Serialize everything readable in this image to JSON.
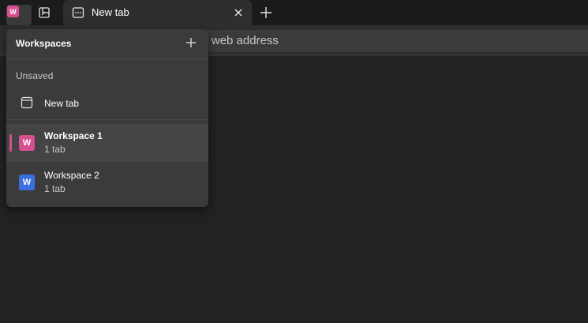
{
  "colors": {
    "accent_pink": "#d6508f",
    "accent_blue": "#3b6fe0"
  },
  "tabstrip": {
    "workspace_badge": "W",
    "active_tab_title": "New tab"
  },
  "toolbar": {
    "address_text": "ch or enter web address"
  },
  "workspaces_flyout": {
    "title": "Workspaces",
    "section_label": "Unsaved",
    "unsaved_item_label": "New tab",
    "items": [
      {
        "badge": "W",
        "name": "Workspace 1",
        "count": "1 tab",
        "color": "#d6508f"
      },
      {
        "badge": "W",
        "name": "Workspace 2",
        "count": "1 tab",
        "color": "#3b6fe0"
      }
    ]
  }
}
